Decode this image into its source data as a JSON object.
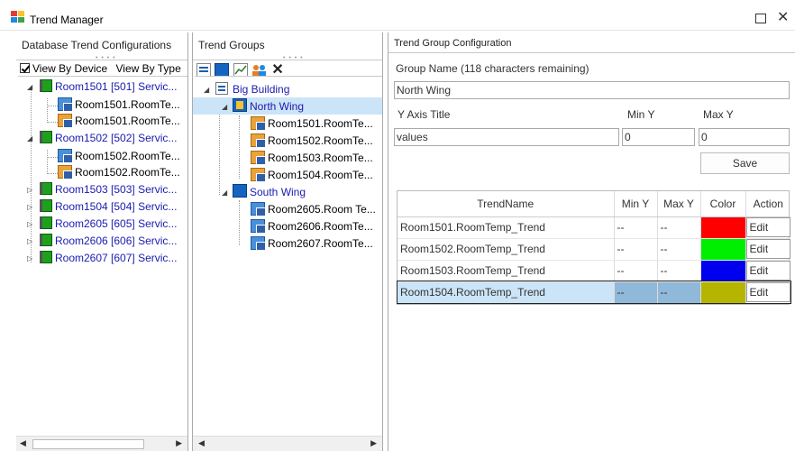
{
  "window": {
    "title": "Trend Manager",
    "maximize_icon": "maximize-icon",
    "close_icon": "close-icon",
    "close_glyph": "✕"
  },
  "panel1": {
    "title": "Database Trend Configurations",
    "view_by_device": "View By Device",
    "view_by_type": "View By Type",
    "tree": [
      {
        "label": "Room1501 [501] Servic...",
        "children": [
          "Room1501.RoomTe...",
          "Room1501.RoomTe..."
        ]
      },
      {
        "label": "Room1502 [502] Servic...",
        "children": [
          "Room1502.RoomTe...",
          "Room1502.RoomTe..."
        ]
      },
      {
        "label": "Room1503 [503] Servic..."
      },
      {
        "label": "Room1504 [504] Servic..."
      },
      {
        "label": "Room2605 [605] Servic..."
      },
      {
        "label": "Room2606 [606] Servic..."
      },
      {
        "label": "Room2607 [607] Servic..."
      }
    ]
  },
  "panel2": {
    "title": "Trend Groups",
    "root": "Big Building",
    "groups": [
      {
        "label": "North Wing",
        "children": [
          "Room1501.RoomTe...",
          "Room1502.RoomTe...",
          "Room1503.RoomTe...",
          "Room1504.RoomTe..."
        ]
      },
      {
        "label": "South Wing",
        "children": [
          "Room2605.Room Te...",
          "Room2606.RoomTe...",
          "Room2607.RoomTe..."
        ]
      }
    ]
  },
  "panel3": {
    "title": "Trend Group Configuration",
    "group_name_label": "Group Name (118 characters remaining)",
    "group_name_value": "North Wing",
    "y_axis_title_label": "Y Axis Title",
    "min_y_label": "Min Y",
    "max_y_label": "Max Y",
    "y_axis_title_value": "values",
    "min_y_value": "0",
    "max_y_value": "0",
    "save_label": "Save",
    "columns": [
      "TrendName",
      "Min Y",
      "Max Y",
      "Color",
      "Action"
    ],
    "rows": [
      {
        "name": "Room1501.RoomTemp_Trend",
        "min": "--",
        "max": "--",
        "color": "#ff0000",
        "action": "Edit"
      },
      {
        "name": "Room1502.RoomTemp_Trend",
        "min": "--",
        "max": "--",
        "color": "#00ee00",
        "action": "Edit"
      },
      {
        "name": "Room1503.RoomTemp_Trend",
        "min": "--",
        "max": "--",
        "color": "#0000ee",
        "action": "Edit"
      },
      {
        "name": "Room1504.RoomTemp_Trend",
        "min": "--",
        "max": "--",
        "color": "#b5b500",
        "action": "Edit"
      }
    ]
  }
}
